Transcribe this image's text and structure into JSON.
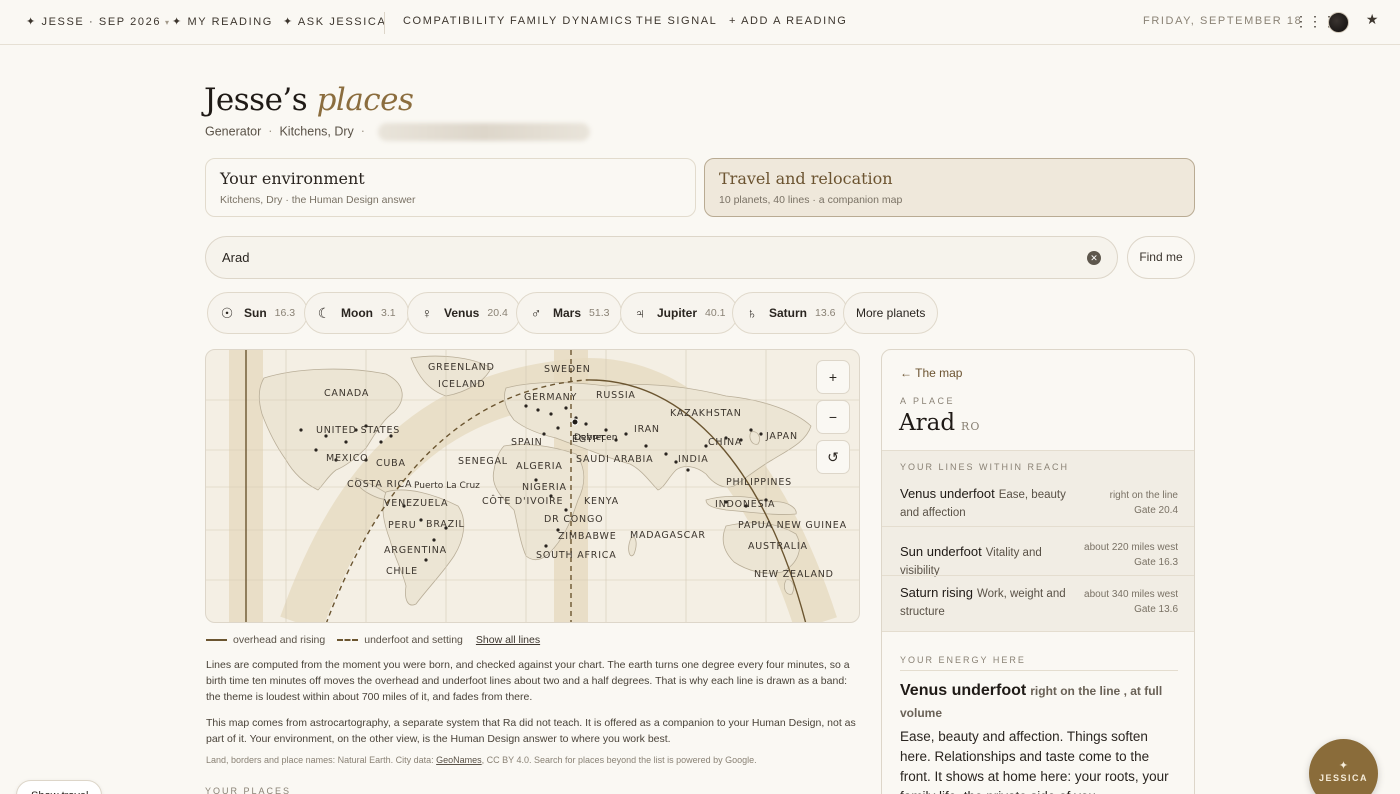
{
  "nav": {
    "profile": "✦ JESSE · SEP 2026",
    "profile_caret": "▾",
    "my_reading": "✦ MY READING",
    "ask_jessica": "✦ ASK JESSICA",
    "compatibility": "COMPATIBILITY",
    "family_dynamics": "FAMILY DYNAMICS",
    "the_signal": "THE SIGNAL",
    "add_reading": "+ ADD A READING",
    "date": "FRIDAY, SEPTEMBER 18",
    "dots": "⋮⋮⋮",
    "star": "★"
  },
  "header": {
    "title_main": "Jesse’s",
    "title_em": "places",
    "sub_type": "Generator",
    "sub_env": "Kitchens, Dry",
    "sep": "·"
  },
  "cards": [
    {
      "title": "Your environment",
      "sub": "Kitchens, Dry · the Human Design answer",
      "active": false
    },
    {
      "title": "Travel and relocation",
      "sub": "10 planets, 40 lines · a companion map",
      "active": true
    }
  ],
  "search": {
    "value": "Arad",
    "clear": "✕",
    "find_me": "Find me"
  },
  "planets": [
    {
      "glyph": "☉",
      "name": "Sun",
      "value": "16.3"
    },
    {
      "glyph": "☾",
      "name": "Moon",
      "value": "3.1"
    },
    {
      "glyph": "♀",
      "name": "Venus",
      "value": "20.4"
    },
    {
      "glyph": "♂",
      "name": "Mars",
      "value": "51.3"
    },
    {
      "glyph": "♃",
      "name": "Jupiter",
      "value": "40.1"
    },
    {
      "glyph": "♄",
      "name": "Saturn",
      "value": "13.6"
    }
  ],
  "more_planets": "More planets",
  "map": {
    "zoom_in": "+",
    "zoom_out": "−",
    "reset": "↺",
    "labels": [
      "GREENLAND",
      "ICELAND",
      "SWEDEN",
      "CANADA",
      "GERMANY",
      "RUSSIA",
      "KAZAKHSTAN",
      "UNITED STATES",
      "SPAIN",
      "IRAN",
      "CHINA",
      "JAPAN",
      "MEXICO",
      "CUBA",
      "EGYPT",
      "SENEGAL",
      "ALGERIA",
      "SAUDI ARABIA",
      "INDIA",
      "COSTA RICA",
      "Puerto La Cruz",
      "NIGERIA",
      "PHILIPPINES",
      "VENEZUELA",
      "CÔTE D'IVOIRE",
      "KENYA",
      "PERU",
      "BRAZIL",
      "DR CONGO",
      "INDONESIA",
      "PAPUA NEW GUINEA",
      "ZIMBABWE",
      "MADAGASCAR",
      "ARGENTINA",
      "SOUTH AFRICA",
      "AUSTRALIA",
      "CHILE",
      "NEW ZEALAND",
      "Debrecen"
    ]
  },
  "legend": {
    "overhead": "overhead and rising",
    "underfoot": "underfoot and setting",
    "show_all": "Show all lines"
  },
  "para1": "Lines are computed from the moment you were born, and checked against your chart. The earth turns one degree every four minutes, so a birth time ten minutes off moves the overhead and underfoot lines about two and a half degrees. That is why each line is drawn as a band: the theme is loudest within about 700 miles of it, and fades from there.",
  "para2": "This map comes from astrocartography, a separate system that Ra did not teach. It is offered as a companion to your Human Design, not as part of it. Your environment, on the other view, is the Human Design answer to where you work best.",
  "credit": {
    "pre": "Land, borders and place names: Natural Earth. City data: ",
    "link": "GeoNames",
    "post": ", CC BY 4.0. Search for places beyond the list is powered by Google."
  },
  "your_places": "YOUR PLACES",
  "bottom_pill": "Show travel",
  "panel": {
    "back": "← The map",
    "label": "A PLACE",
    "name": "Arad",
    "country": "RO",
    "lines_label": "YOUR LINES WITHIN REACH",
    "lines": [
      {
        "name": "Venus underfoot",
        "desc": "Ease, beauty and affection",
        "dist": "right on the line",
        "gate": "Gate 20.4"
      },
      {
        "name": "Sun underfoot",
        "desc": "Vitality and visibility",
        "dist": "about 220 miles west",
        "gate": "Gate 16.3"
      },
      {
        "name": "Saturn rising",
        "desc": "Work, weight and structure",
        "dist": "about 340 miles west",
        "gate": "Gate 13.6"
      }
    ],
    "energy_label": "YOUR ENERGY HERE",
    "energy_name": "Venus underfoot",
    "energy_meta": "right on the line , at full volume",
    "energy_body": "Ease, beauty and affection. Things soften here. Relationships and taste come to the front. It shows at home here: your roots, your family life, the private side of you."
  },
  "fab": {
    "star": "✦",
    "label": "JESSICA"
  },
  "colors": {
    "accent": "#8b6d3e",
    "background": "#faf8f3",
    "active_card": "#efe8db"
  }
}
